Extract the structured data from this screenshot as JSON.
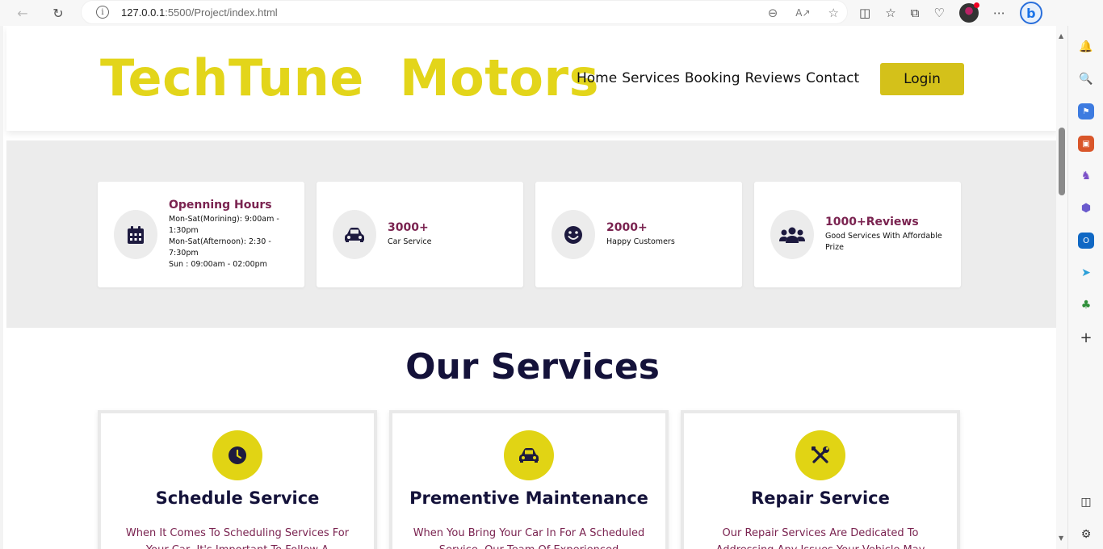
{
  "browser": {
    "url_host": "127.0.0.1",
    "url_rest": ":5500/Project/index.html"
  },
  "header": {
    "brand": "TechTune  Motors",
    "nav": [
      "Home",
      "Services",
      "Booking",
      "Reviews",
      "Contact"
    ],
    "login_label": "Login"
  },
  "stats": [
    {
      "icon": "calendar-icon",
      "title": "Openning Hours",
      "lines": [
        "Mon-Sat(Morining): 9:00am - 1:30pm",
        "Mon-Sat(Afternoon): 2:30 - 7:30pm",
        "Sun : 09:00am - 02:00pm"
      ]
    },
    {
      "icon": "car-icon",
      "title": "3000+",
      "lines": [
        "Car Service"
      ]
    },
    {
      "icon": "smile-icon",
      "title": "2000+",
      "lines": [
        "Happy Customers"
      ]
    },
    {
      "icon": "users-icon",
      "title": "1000+Reviews",
      "lines": [
        "Good Services With Affordable Prize"
      ]
    }
  ],
  "services": {
    "heading": "Our Services",
    "cards": [
      {
        "icon": "clock-icon",
        "title": "Schedule Service",
        "desc": "When It Comes To Scheduling Services For Your Car, It's Important To Follow A"
      },
      {
        "icon": "car-icon",
        "title": "Prementive Maintenance",
        "desc": "When You Bring Your Car In For A Scheduled Service, Our Team Of Experienced Technicians"
      },
      {
        "icon": "tools-icon",
        "title": "Repair Service",
        "desc": "Our Repair Services Are Dedicated To Addressing Any Issues Your Vehicle May"
      }
    ]
  },
  "colors": {
    "brand": "#e3d51a",
    "login_bg": "#d4c11a",
    "stat_title": "#7a2350",
    "heading": "#14123a",
    "icon_dark": "#1d1a3f"
  }
}
